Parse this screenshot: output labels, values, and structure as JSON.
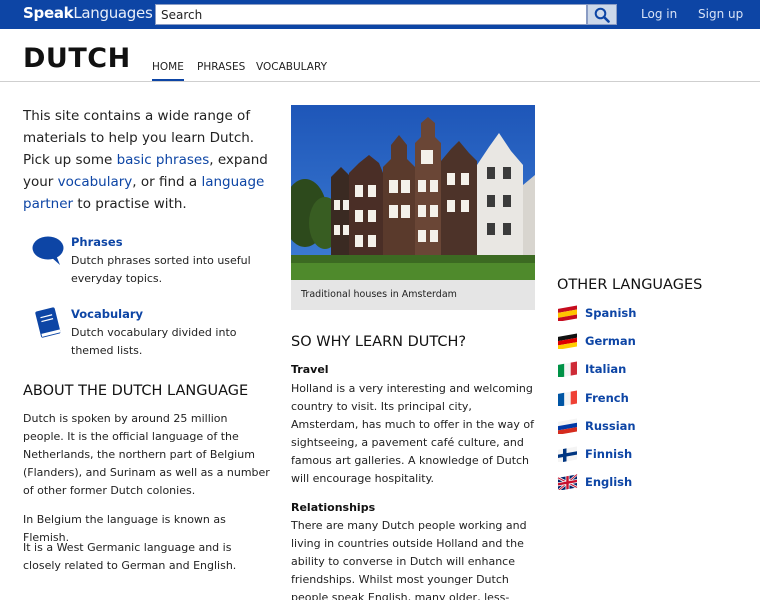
{
  "header": {
    "logo_part1": "Speak",
    "logo_part2": "Languages",
    "search_placeholder": "Search",
    "login_label": "Log in",
    "signup_label": "Sign up"
  },
  "page": {
    "title": "DUTCH",
    "tabs": [
      {
        "label": "HOME",
        "active": true
      },
      {
        "label": "PHRASES",
        "active": false
      },
      {
        "label": "VOCABULARY",
        "active": false
      }
    ]
  },
  "intro": {
    "t1": "This site contains a wide range of materials to help you learn Dutch. Pick up some ",
    "link1": "basic phrases",
    "t2": ", expand your ",
    "link2": "vocabulary",
    "t3": ", or find a ",
    "link3": "language partner",
    "t4": " to practise with."
  },
  "features": [
    {
      "title": "Phrases",
      "desc": "Dutch phrases sorted into useful everyday topics.",
      "icon": "speech-bubble-icon"
    },
    {
      "title": "Vocabulary",
      "desc": "Dutch vocabulary divided into themed lists.",
      "icon": "book-icon"
    }
  ],
  "about": {
    "heading": "ABOUT THE DUTCH LANGUAGE",
    "paragraphs": [
      "Dutch is spoken by around 25 million people. It is the official language of the Netherlands, the northern part of Belgium (Flanders), and Surinam as well as a number of other former Dutch colonies.",
      "In Belgium the language is known as Flemish.",
      "It is a West Germanic language and is closely related to German and English."
    ]
  },
  "photo": {
    "caption": "Traditional houses in Amsterdam"
  },
  "why": {
    "heading": "SO WHY LEARN DUTCH?",
    "sections": [
      {
        "title": "Travel",
        "text": "Holland is a very interesting and welcoming country to visit. Its principal city, Amsterdam, has much to offer in the way of sightseeing, a pavement café culture, and famous art galleries. A knowledge of Dutch will encourage hospitality."
      },
      {
        "title": "Relationships",
        "text": "There are many Dutch people working and living in countries outside Holland and the ability to converse in Dutch will enhance friendships. Whilst most younger Dutch people speak English, many older, less-travelled"
      }
    ]
  },
  "other_languages": {
    "heading": "OTHER LANGUAGES",
    "items": [
      "Spanish",
      "German",
      "Italian",
      "French",
      "Russian",
      "Finnish",
      "English"
    ]
  },
  "colors": {
    "brand_blue": "#0d45a5",
    "caption_bg": "#e5e5e5"
  }
}
